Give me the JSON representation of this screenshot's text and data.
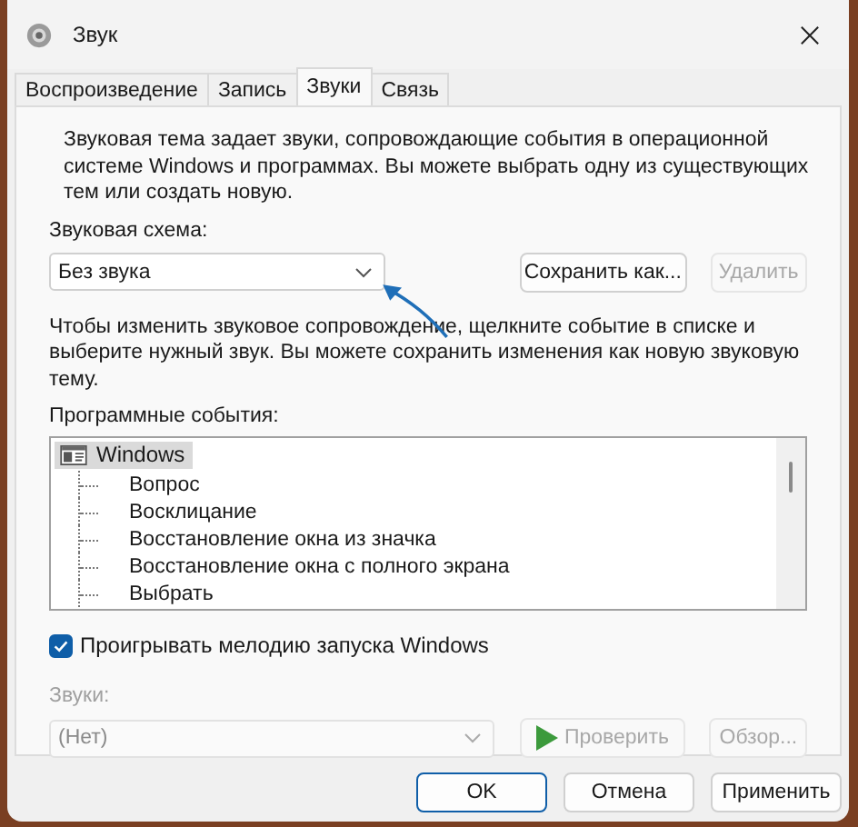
{
  "window": {
    "title": "Звук"
  },
  "tabs": [
    {
      "label": "Воспроизведение",
      "selected": false
    },
    {
      "label": "Запись",
      "selected": false
    },
    {
      "label": "Звуки",
      "selected": true
    },
    {
      "label": "Связь",
      "selected": false
    }
  ],
  "description": "Звуковая тема задает звуки, сопровождающие события в операционной системе Windows и программах. Вы можете выбрать одну из существующих тем или создать новую.",
  "scheme": {
    "label": "Звуковая схема:",
    "value": "Без звука",
    "save_button": {
      "label": "Сохранить как...",
      "disabled": false
    },
    "delete_button": {
      "label": "Удалить",
      "disabled": true
    }
  },
  "hint": "Чтобы изменить звуковое сопровождение, щелкните событие в списке и выберите нужный звук. Вы можете сохранить изменения как новую звуковую тему.",
  "events": {
    "label": "Программные события:",
    "tree": [
      {
        "label": "Windows",
        "selected": true,
        "children": [
          {
            "label": "Вопрос",
            "selected": false
          },
          {
            "label": "Восклицание",
            "selected": false
          },
          {
            "label": "Восстановление окна из значка",
            "selected": false
          },
          {
            "label": "Восстановление окна с полного экрана",
            "selected": false
          },
          {
            "label": "Выбрать",
            "selected": false
          }
        ]
      }
    ]
  },
  "startup_sound": {
    "label": "Проигрывать мелодию запуска Windows",
    "checked": true
  },
  "sounds": {
    "label": "Звуки:",
    "value": "(Нет)",
    "disabled": true,
    "test_button": {
      "label": "Проверить",
      "disabled": true
    },
    "browse_button": {
      "label": "Обзор...",
      "disabled": true
    }
  },
  "buttons": [
    {
      "label": "OK",
      "default": true
    },
    {
      "label": "Отмена",
      "default": false
    },
    {
      "label": "Применить",
      "default": false
    }
  ]
}
